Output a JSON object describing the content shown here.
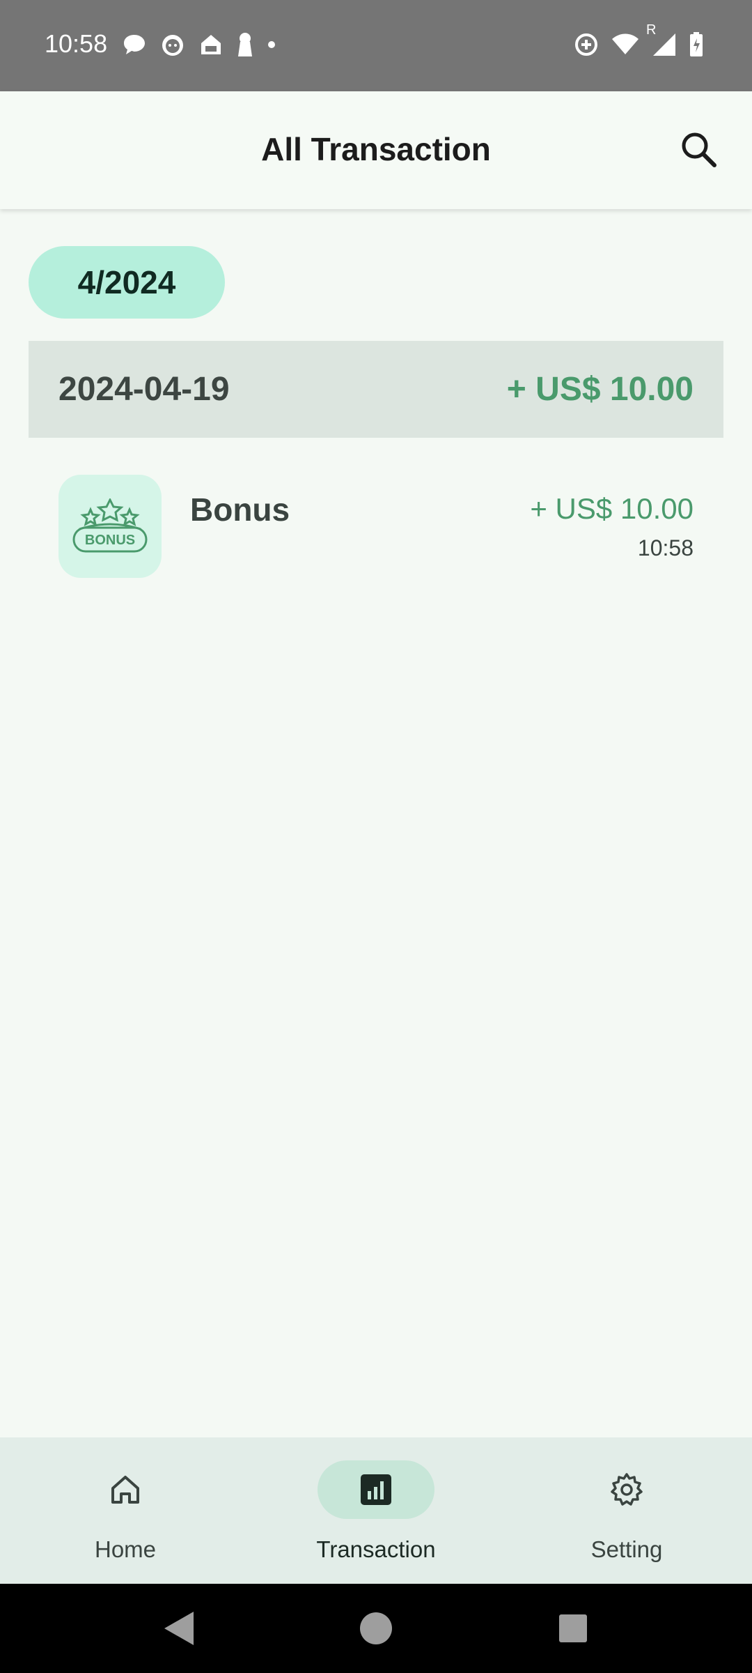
{
  "status_bar": {
    "time": "10:58",
    "left_icons": [
      "chat-bubble-icon",
      "cat-face-icon",
      "home-outline-icon",
      "keyhole-icon",
      "dot-icon"
    ],
    "right_icons": [
      "data-saver-icon",
      "wifi-icon",
      "signal-roaming-icon",
      "battery-charging-icon"
    ],
    "roaming_letter": "R"
  },
  "app_bar": {
    "title": "All Transaction",
    "search_icon": "search-icon"
  },
  "month_filter": {
    "label": "4/2024"
  },
  "groups": [
    {
      "date": "2024-04-19",
      "total": "+ US$ 10.00",
      "transactions": [
        {
          "name": "Bonus",
          "amount": "+ US$ 10.00",
          "time": "10:58",
          "icon": "bonus-badge-icon",
          "icon_text": "BONUS"
        }
      ]
    }
  ],
  "bottom_nav": {
    "items": [
      {
        "label": "Home",
        "icon": "home-icon",
        "active": false
      },
      {
        "label": "Transaction",
        "icon": "bar-chart-icon",
        "active": true
      },
      {
        "label": "Setting",
        "icon": "gear-icon",
        "active": false
      }
    ]
  },
  "colors": {
    "accent_green": "#4a9a6c",
    "chip_bg": "#b5efdc",
    "date_header_bg": "#dce5df",
    "nav_bg": "#e2ede8",
    "status_bar_bg": "#757575"
  }
}
